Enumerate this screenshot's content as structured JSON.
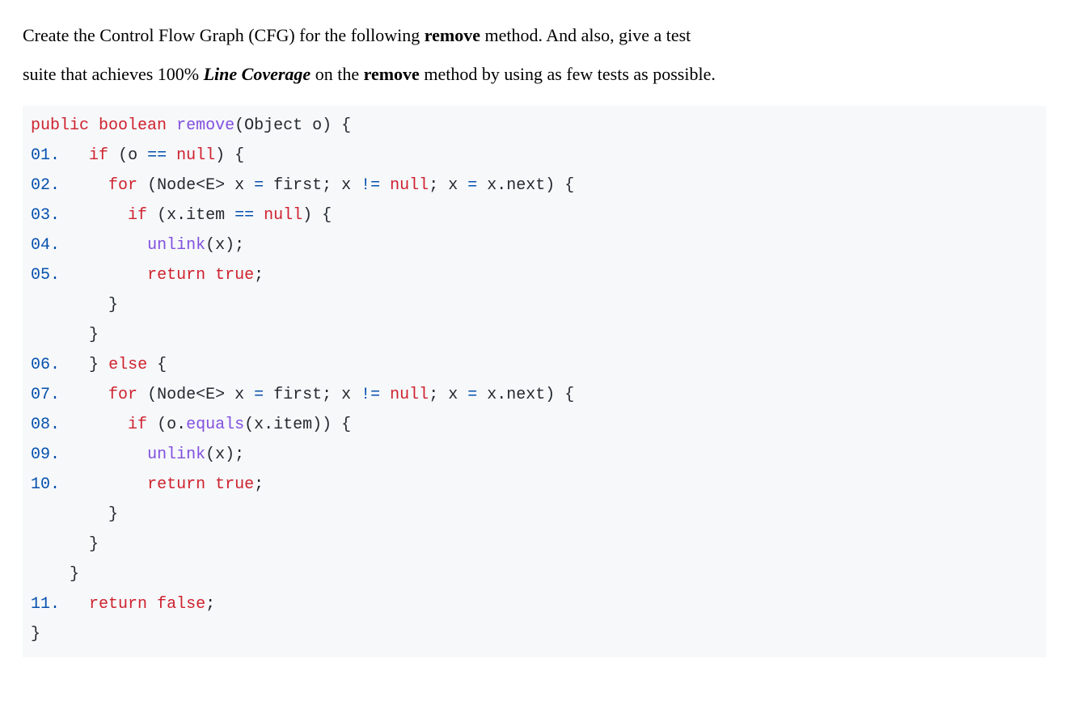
{
  "prose": {
    "p1a": "Create the Control Flow Graph (CFG) for the following ",
    "p1b": "remove",
    "p1c": " method. And also, give a test",
    "p2a": "suite that achieves 100% ",
    "p2b": "Line Coverage",
    "p2c": " on the ",
    "p2d": "remove",
    "p2e": " method by using as few tests as possible."
  },
  "code": {
    "sig": {
      "kw_public": "public",
      "kw_boolean": "boolean",
      "fn_remove": "remove",
      "params": "(Object o) {"
    },
    "lines": {
      "l01": {
        "num": "01",
        "dot": ".",
        "parts": [
          "if",
          " (o ",
          "==",
          " ",
          "null",
          ") {"
        ]
      },
      "l02": {
        "num": "02",
        "dot": ".",
        "parts": [
          "for",
          " (Node<E> x ",
          "=",
          " first; x ",
          "!=",
          " ",
          "null",
          "; x ",
          "=",
          " x.next) {"
        ]
      },
      "l03": {
        "num": "03",
        "dot": ".",
        "parts": [
          "if",
          " (x.item ",
          "==",
          " ",
          "null",
          ") {"
        ]
      },
      "l04": {
        "num": "04",
        "dot": ".",
        "parts": [
          "unlink",
          "(x);"
        ]
      },
      "l05": {
        "num": "05",
        "dot": ".",
        "parts": [
          "return",
          " ",
          "true",
          ";"
        ]
      },
      "close1": "        }",
      "close2": "      }",
      "l06": {
        "num": "06",
        "dot": ".",
        "parts": [
          "} ",
          "else",
          " {"
        ]
      },
      "l07": {
        "num": "07",
        "dot": ".",
        "parts": [
          "for",
          " (Node<E> x ",
          "=",
          " first; x ",
          "!=",
          " ",
          "null",
          "; x ",
          "=",
          " x.next) {"
        ]
      },
      "l08": {
        "num": "08",
        "dot": ".",
        "parts": [
          "if",
          " (o.",
          "equals",
          "(x.item)) {"
        ]
      },
      "l09": {
        "num": "09",
        "dot": ".",
        "parts": [
          "unlink",
          "(x);"
        ]
      },
      "l10": {
        "num": "10",
        "dot": ".",
        "parts": [
          "return",
          " ",
          "true",
          ";"
        ]
      },
      "close3": "        }",
      "close4": "      }",
      "close5": "    }",
      "l11": {
        "num": "11",
        "dot": ".",
        "parts": [
          "return",
          " ",
          "false",
          ";"
        ]
      },
      "close6": "}"
    }
  }
}
